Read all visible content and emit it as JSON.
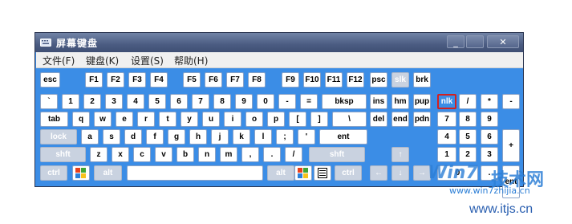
{
  "window": {
    "title": "屏幕键盘",
    "min_label": "_",
    "max_label": "",
    "close_label": "✕"
  },
  "menu": [
    "文件(F)",
    "键盘(K)",
    "设置(S)",
    "帮助(H)"
  ],
  "rows": [
    [
      {
        "label": "esc"
      },
      {
        "label": "F1"
      },
      {
        "label": "F2"
      },
      {
        "label": "F3"
      },
      {
        "label": "F4"
      },
      {
        "label": "F5"
      },
      {
        "label": "F6"
      },
      {
        "label": "F7"
      },
      {
        "label": "F8"
      },
      {
        "label": "F9"
      },
      {
        "label": "F10"
      },
      {
        "label": "F11"
      },
      {
        "label": "F12"
      },
      {
        "label": "psc"
      },
      {
        "label": "slk",
        "disabled": true
      },
      {
        "label": "brk"
      }
    ],
    [
      {
        "label": "`"
      },
      {
        "label": "1"
      },
      {
        "label": "2"
      },
      {
        "label": "3"
      },
      {
        "label": "4"
      },
      {
        "label": "5"
      },
      {
        "label": "6"
      },
      {
        "label": "7"
      },
      {
        "label": "8"
      },
      {
        "label": "9"
      },
      {
        "label": "0"
      },
      {
        "label": "-"
      },
      {
        "label": "="
      },
      {
        "label": "bksp"
      },
      {
        "label": "ins"
      },
      {
        "label": "hm"
      },
      {
        "label": "pup"
      },
      {
        "label": "nlk",
        "active": true
      },
      {
        "label": "/"
      },
      {
        "label": "*"
      },
      {
        "label": "-"
      }
    ],
    [
      {
        "label": "tab"
      },
      {
        "label": "q"
      },
      {
        "label": "w"
      },
      {
        "label": "e"
      },
      {
        "label": "r"
      },
      {
        "label": "t"
      },
      {
        "label": "y"
      },
      {
        "label": "u"
      },
      {
        "label": "i"
      },
      {
        "label": "o"
      },
      {
        "label": "p"
      },
      {
        "label": "["
      },
      {
        "label": "]"
      },
      {
        "label": "\\"
      },
      {
        "label": "del"
      },
      {
        "label": "end"
      },
      {
        "label": "pdn"
      },
      {
        "label": "7"
      },
      {
        "label": "8"
      },
      {
        "label": "9"
      }
    ],
    [
      {
        "label": "lock",
        "disabled": true
      },
      {
        "label": "a"
      },
      {
        "label": "s"
      },
      {
        "label": "d"
      },
      {
        "label": "f"
      },
      {
        "label": "g"
      },
      {
        "label": "h"
      },
      {
        "label": "j"
      },
      {
        "label": "k"
      },
      {
        "label": "l"
      },
      {
        "label": ";"
      },
      {
        "label": "'"
      },
      {
        "label": "ent"
      },
      {
        "label": "4"
      },
      {
        "label": "5"
      },
      {
        "label": "6"
      },
      {
        "label": "+"
      }
    ],
    [
      {
        "label": "shft",
        "disabled": true
      },
      {
        "label": "z"
      },
      {
        "label": "x"
      },
      {
        "label": "c"
      },
      {
        "label": "v"
      },
      {
        "label": "b"
      },
      {
        "label": "n"
      },
      {
        "label": "m"
      },
      {
        "label": ","
      },
      {
        "label": "."
      },
      {
        "label": "/"
      },
      {
        "label": "shft",
        "disabled": true
      },
      {
        "label": "↑",
        "disabled": true
      },
      {
        "label": "1"
      },
      {
        "label": "2"
      },
      {
        "label": "3"
      }
    ],
    [
      {
        "label": "ctrl",
        "disabled": true
      },
      {
        "label": "win-icon",
        "icon": true
      },
      {
        "label": "alt",
        "disabled": true
      },
      {
        "label": ""
      },
      {
        "label": "alt",
        "disabled": true
      },
      {
        "label": "win-icon",
        "icon": true
      },
      {
        "label": "menu-icon",
        "icon": true
      },
      {
        "label": "ctrl",
        "disabled": true
      },
      {
        "label": "←",
        "disabled": true
      },
      {
        "label": "↓",
        "disabled": true
      },
      {
        "label": "→",
        "disabled": true
      },
      {
        "label": "0"
      },
      {
        "label": "."
      },
      {
        "label": "ent"
      }
    ]
  ],
  "watermark": {
    "brand": "Win7",
    "brand_cn": "技术网",
    "small": "www.win7zhijia.cn",
    "url": "www.itjs.cn"
  }
}
